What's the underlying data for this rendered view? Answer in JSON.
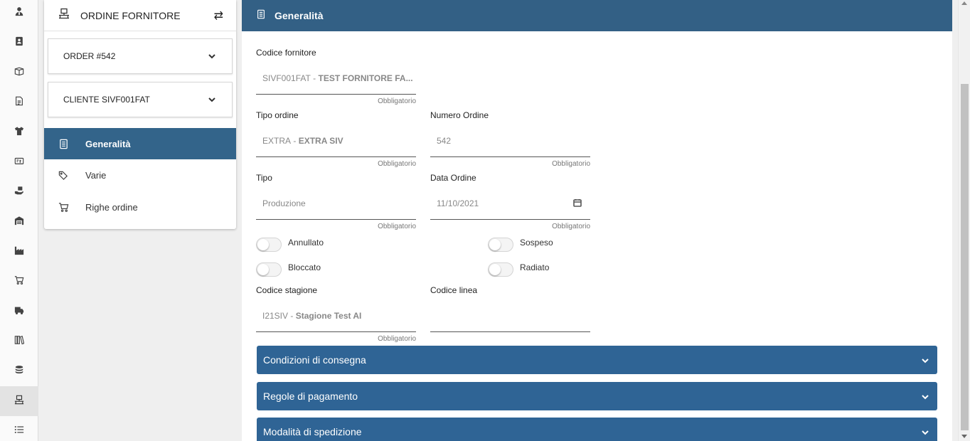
{
  "rail": {
    "items": [
      {
        "icon": "user-tie-icon"
      },
      {
        "icon": "address-book-icon"
      },
      {
        "icon": "box-open-icon"
      },
      {
        "icon": "file-lines-icon"
      },
      {
        "icon": "shirt-icon"
      },
      {
        "icon": "file-invoice-icon"
      },
      {
        "icon": "hand-holding-box-icon"
      },
      {
        "icon": "warehouse-icon"
      },
      {
        "icon": "industry-icon"
      },
      {
        "icon": "cart-icon"
      },
      {
        "icon": "truck-icon"
      },
      {
        "icon": "books-icon"
      },
      {
        "icon": "coins-icon"
      },
      {
        "icon": "supplier-order-icon"
      },
      {
        "icon": "list-icon"
      }
    ],
    "active_index": 13
  },
  "left_panel": {
    "title": "ORDINE FORNITORE",
    "order_dropdown": "ORDER #542",
    "client_dropdown": "CLIENTE SIVF001FAT",
    "nav": [
      {
        "label": "Generalità",
        "icon": "document-list-icon",
        "active": true
      },
      {
        "label": "Varie",
        "icon": "tags-icon",
        "active": false
      },
      {
        "label": "Righe ordine",
        "icon": "cart-icon",
        "active": false
      }
    ]
  },
  "main": {
    "title": "Generalità",
    "fields": {
      "codice_fornitore": {
        "label": "Codice fornitore",
        "code": "SIVF001FAT",
        "name": "TEST FORNITORE FA...",
        "hint": "Obbligatorio"
      },
      "tipo_ordine": {
        "label": "Tipo ordine",
        "code": "EXTRA",
        "name": "EXTRA SIV",
        "hint": "Obbligatorio"
      },
      "numero_ordine": {
        "label": "Numero Ordine",
        "value": "542",
        "hint": "Obbligatorio"
      },
      "tipo": {
        "label": "Tipo",
        "value": "Produzione",
        "hint": "Obbligatorio"
      },
      "data_ordine": {
        "label": "Data Ordine",
        "value": "11/10/2021",
        "hint": "Obbligatorio"
      },
      "codice_stagione": {
        "label": "Codice stagione",
        "code": "I21SIV",
        "name": "Stagione Test AI",
        "hint": "Obbligatorio"
      },
      "codice_linea": {
        "label": "Codice linea",
        "value": ""
      }
    },
    "toggles": {
      "annullato": {
        "label": "Annullato",
        "on": false
      },
      "sospeso": {
        "label": "Sospeso",
        "on": false
      },
      "bloccato": {
        "label": "Bloccato",
        "on": false
      },
      "radiato": {
        "label": "Radiato",
        "on": false
      }
    },
    "sections": [
      {
        "label": "Condizioni di consegna"
      },
      {
        "label": "Regole di pagamento"
      },
      {
        "label": "Modalità di spedizione"
      }
    ]
  },
  "colors": {
    "header_blue": "#336085",
    "nav_active": "#33648a",
    "accordion_blue": "#2f6495"
  }
}
